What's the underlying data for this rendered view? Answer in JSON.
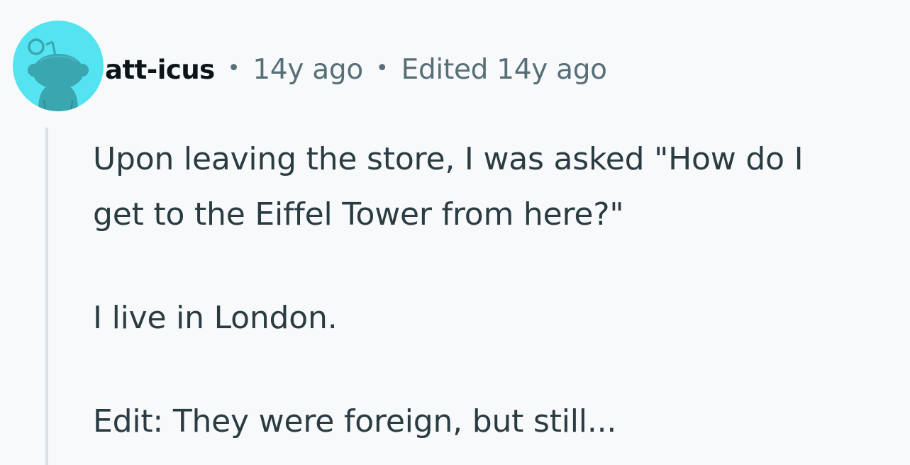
{
  "comment": {
    "author": "att-icus",
    "separator": "•",
    "timestamp": "14y ago",
    "edited": "Edited 14y ago",
    "body": {
      "line1": "Upon leaving the store, I was asked \"How do I",
      "line2": "get to the Eiffel Tower from here?\"",
      "paragraph2": "I live in London.",
      "paragraph3": "Edit: They were foreign, but still..."
    }
  },
  "avatar": {
    "icon": "reddit-snoo-avatar-icon",
    "background": "#54e3f0",
    "figure_color": "#3aa6b0"
  },
  "colors": {
    "page_background": "#f8f9fb",
    "author": "#0b1416",
    "meta": "#576f76",
    "body": "#2a3c42",
    "thread_line": "#d8e2e7"
  }
}
